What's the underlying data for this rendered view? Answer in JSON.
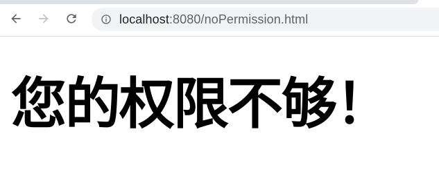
{
  "browser": {
    "address": {
      "host": "localhost",
      "rest": ":8080/noPermission.html"
    },
    "icons": {
      "back": "arrow-left-icon",
      "forward": "arrow-right-icon",
      "reload": "reload-icon",
      "site_info": "info-icon"
    },
    "colors": {
      "omnibox_bg": "#f1f3f4",
      "icon_active": "#5f6368",
      "icon_disabled": "#bdc1c6"
    }
  },
  "page": {
    "message": "您的权限不够！"
  }
}
